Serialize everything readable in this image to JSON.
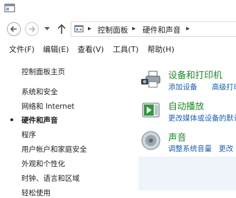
{
  "address": {
    "crumbs": [
      "控制面板",
      "硬件和声音"
    ]
  },
  "menu": [
    "文件(F)",
    "编辑(E)",
    "查看(V)",
    "工具(T)",
    "帮助(H)"
  ],
  "sidebar": {
    "items": [
      {
        "label": "控制面板主页"
      },
      {
        "label": "系统和安全"
      },
      {
        "label": "网络和 Internet"
      },
      {
        "label": "硬件和声音",
        "current": true
      },
      {
        "label": "程序"
      },
      {
        "label": "用户帐户和家庭安全"
      },
      {
        "label": "外观和个性化"
      },
      {
        "label": "时钟、语言和区域"
      },
      {
        "label": "轻松使用"
      }
    ]
  },
  "categories": [
    {
      "title": "设备和打印机",
      "links": [
        "添加设备",
        "高级打印"
      ],
      "icon": "printer-camera-icon"
    },
    {
      "title": "自动播放",
      "links": [
        "更改媒体或设备的默认"
      ],
      "icon": "autoplay-icon"
    },
    {
      "title": "声音",
      "links": [
        "调整系统音量",
        "更改"
      ],
      "icon": "speaker-icon"
    }
  ],
  "colors": {
    "category_title": "#1e8a26",
    "link": "#1a5fb4",
    "panel_fill": "#eef4fa"
  }
}
